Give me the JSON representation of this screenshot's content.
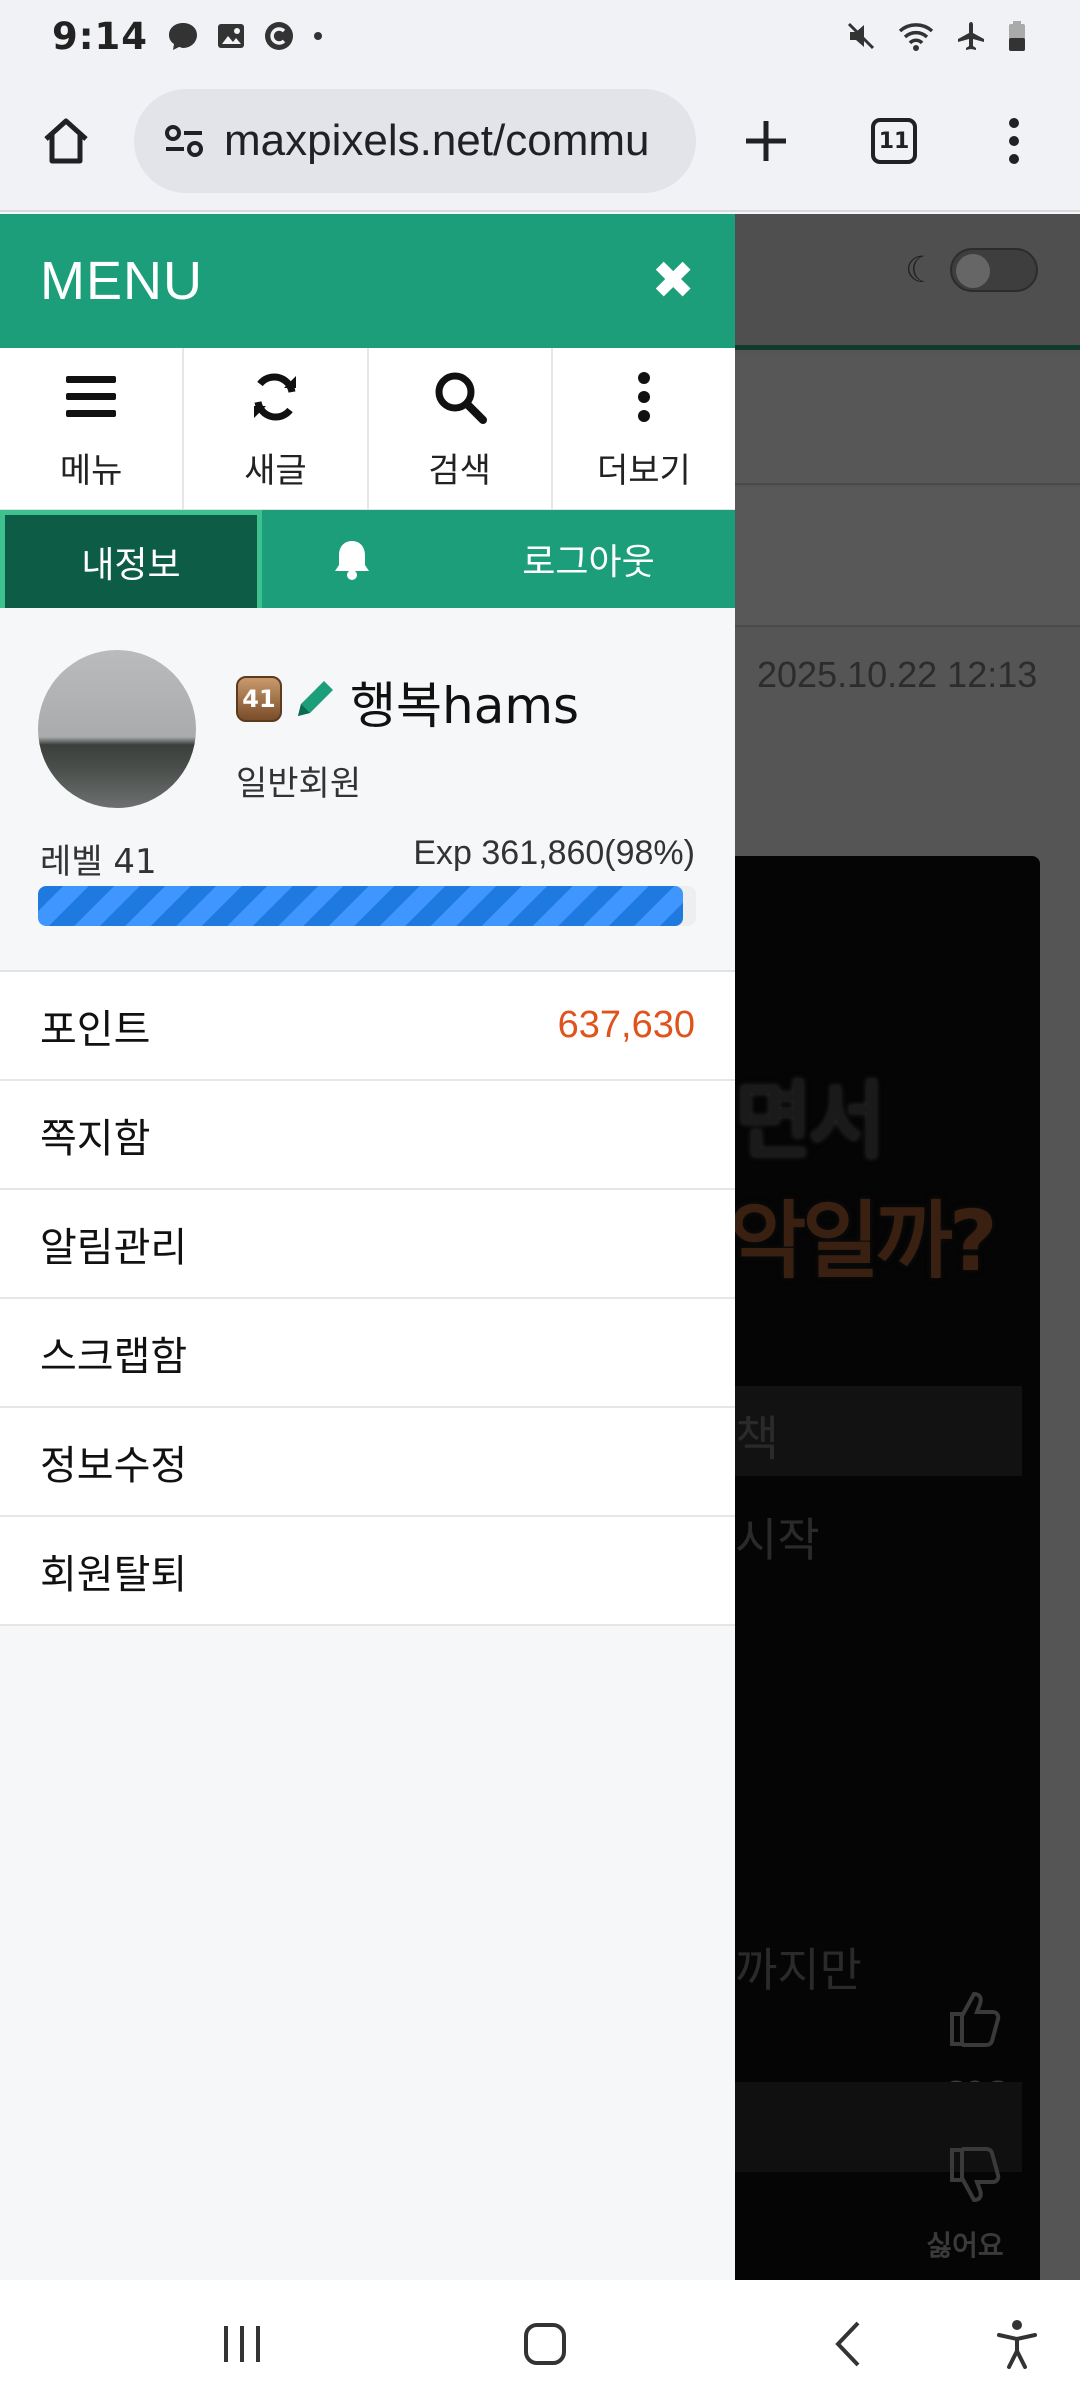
{
  "status_bar": {
    "time": "9:14",
    "left_icons": [
      "messenger-icon",
      "image-icon",
      "c-app-icon",
      "dot-icon"
    ],
    "right_icons": [
      "mute-icon",
      "wifi-icon",
      "airplane-icon",
      "battery-icon"
    ]
  },
  "browser": {
    "url": "maxpixels.net/commu",
    "tab_count": "11"
  },
  "menu": {
    "title": "MENU",
    "quick_actions": [
      {
        "label": "메뉴",
        "icon": "hamburger-icon"
      },
      {
        "label": "새글",
        "icon": "refresh-icon"
      },
      {
        "label": "검색",
        "icon": "search-icon"
      },
      {
        "label": "더보기",
        "icon": "more-vertical-icon"
      }
    ],
    "tabs": {
      "my_info": "내정보",
      "logout": "로그아웃"
    },
    "profile": {
      "level_badge": "41",
      "nickname": "행복hams",
      "grade": "일반회원",
      "level_text": "레벨 41",
      "exp_text": "Exp 361,860(98%)",
      "exp_fraction": 0.98
    },
    "items": [
      {
        "label": "포인트",
        "value": "637,630"
      },
      {
        "label": "쪽지함"
      },
      {
        "label": "알림관리"
      },
      {
        "label": "스크랩함"
      },
      {
        "label": "정보수정"
      },
      {
        "label": "회원탈퇴"
      }
    ]
  },
  "background_page": {
    "date": "2025.10.22 12:13",
    "video_line1": "면서",
    "video_line2": "악일까?",
    "video_bar": "책",
    "video_line3": "시작",
    "video_line4": "까지만",
    "like_count": "606",
    "dislike_label": "싫어요"
  },
  "colors": {
    "menu_green": "#1d9e7a",
    "active_tab": "#0d5c45",
    "point_value": "#e0531c",
    "exp_bar": "#1f7ae0"
  }
}
